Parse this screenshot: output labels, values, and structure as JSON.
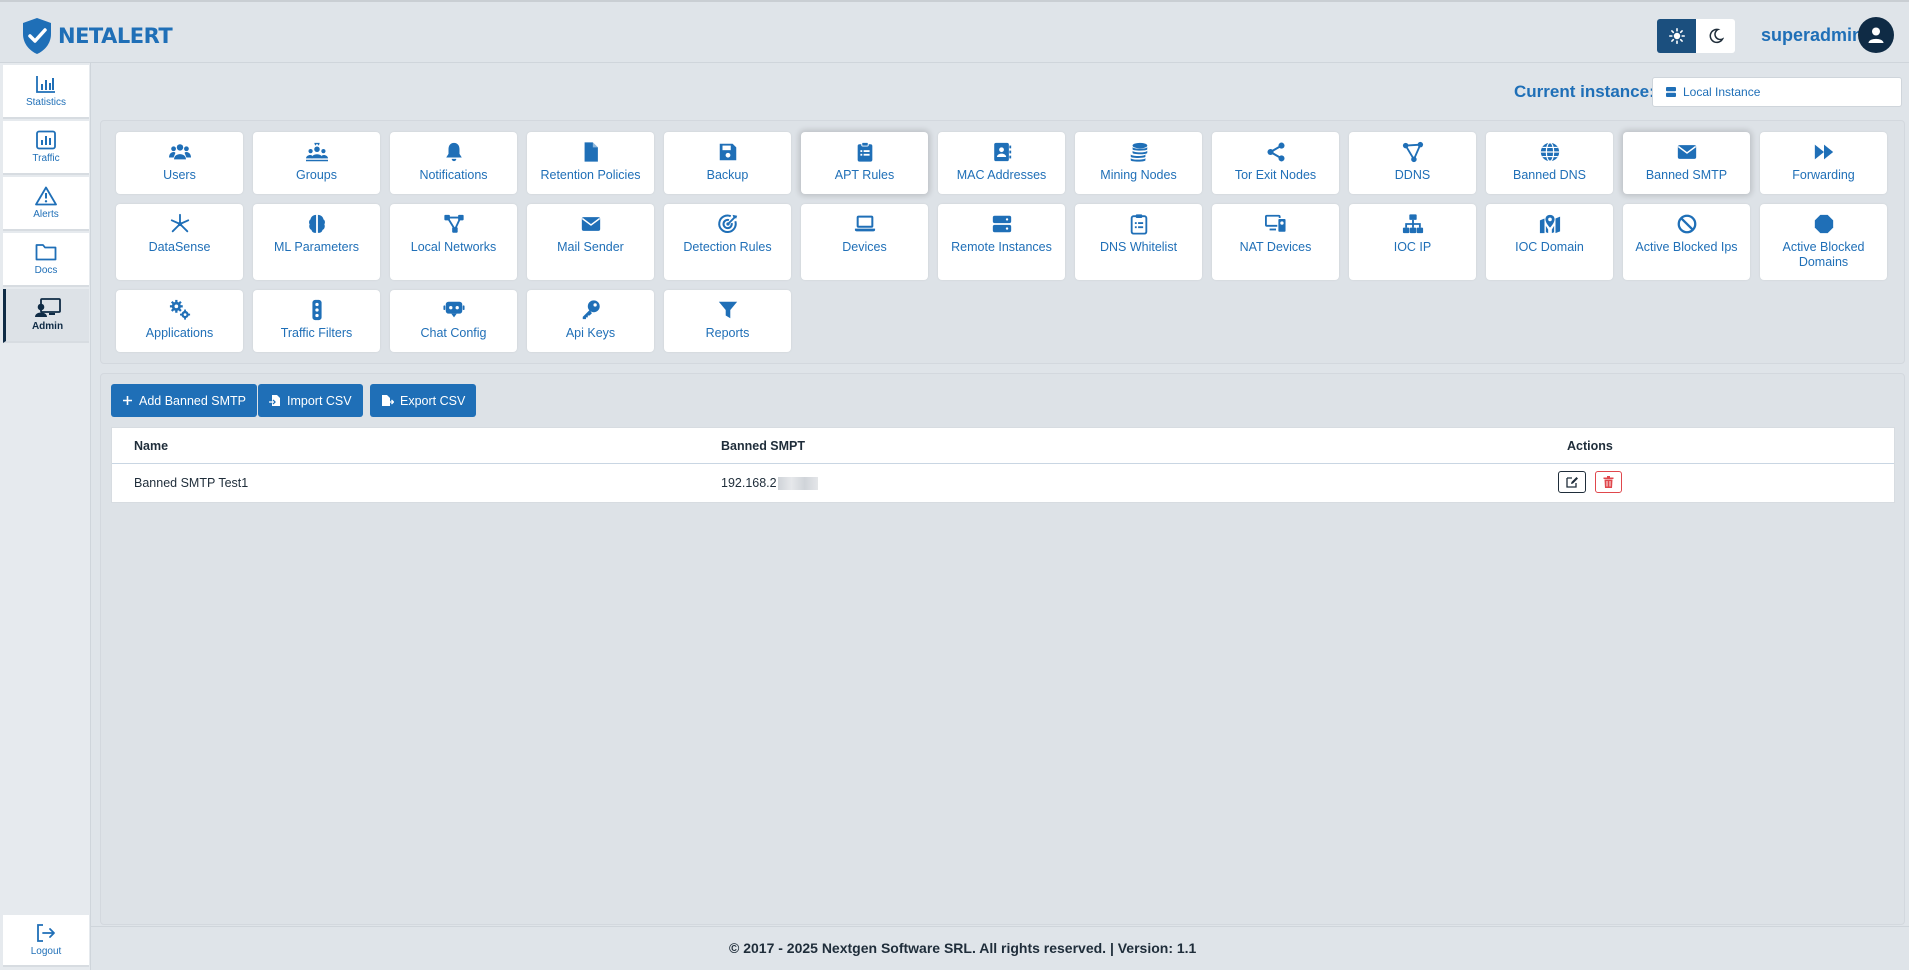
{
  "brand": {
    "name": "NETALERT"
  },
  "header": {
    "username": "superadmin"
  },
  "sidebar": {
    "items": [
      {
        "label": "Statistics",
        "icon": "bar-chart-icon"
      },
      {
        "label": "Traffic",
        "icon": "chart-square-icon"
      },
      {
        "label": "Alerts",
        "icon": "warning-triangle-icon"
      },
      {
        "label": "Docs",
        "icon": "folder-icon"
      },
      {
        "label": "Admin",
        "icon": "admin-screen-icon"
      }
    ],
    "logout": {
      "label": "Logout",
      "icon": "logout-icon"
    }
  },
  "instance": {
    "label": "Current instance:",
    "value": "Local Instance"
  },
  "tiles": [
    {
      "label": "Users",
      "icon": "users-icon"
    },
    {
      "label": "Groups",
      "icon": "groups-icon"
    },
    {
      "label": "Notifications",
      "icon": "bell-icon"
    },
    {
      "label": "Retention Policies",
      "icon": "file-icon"
    },
    {
      "label": "Backup",
      "icon": "floppy-icon"
    },
    {
      "label": "APT Rules",
      "icon": "clipboard-icon"
    },
    {
      "label": "MAC Addresses",
      "icon": "address-book-icon"
    },
    {
      "label": "Mining Nodes",
      "icon": "coins-icon"
    },
    {
      "label": "Tor Exit Nodes",
      "icon": "share-icon"
    },
    {
      "label": "DDNS",
      "icon": "nodes-icon"
    },
    {
      "label": "Banned DNS",
      "icon": "globe-icon"
    },
    {
      "label": "Banned SMTP",
      "icon": "envelope-icon"
    },
    {
      "label": "Forwarding",
      "icon": "forward-icon"
    },
    {
      "label": "DataSense",
      "icon": "sparkle-icon"
    },
    {
      "label": "ML Parameters",
      "icon": "brain-icon"
    },
    {
      "label": "Local Networks",
      "icon": "network-icon"
    },
    {
      "label": "Mail Sender",
      "icon": "envelope-icon"
    },
    {
      "label": "Detection Rules",
      "icon": "target-icon"
    },
    {
      "label": "Devices",
      "icon": "laptop-icon"
    },
    {
      "label": "Remote Instances",
      "icon": "server-icon"
    },
    {
      "label": "DNS Whitelist",
      "icon": "clipboard-list-icon"
    },
    {
      "label": "NAT Devices",
      "icon": "desktop-device-icon"
    },
    {
      "label": "IOC IP",
      "icon": "sitemap-icon"
    },
    {
      "label": "IOC Domain",
      "icon": "map-pin-icon"
    },
    {
      "label": "Active Blocked Ips",
      "icon": "ban-icon"
    },
    {
      "label": "Active Blocked Domains",
      "icon": "octagon-icon"
    },
    {
      "label": "Applications",
      "icon": "gears-icon"
    },
    {
      "label": "Traffic Filters",
      "icon": "traffic-light-icon"
    },
    {
      "label": "Chat Config",
      "icon": "robot-icon"
    },
    {
      "label": "Api Keys",
      "icon": "key-icon"
    },
    {
      "label": "Reports",
      "icon": "filter-icon"
    }
  ],
  "toolbar": {
    "add_label": "Add Banned SMTP",
    "import_label": "Import CSV",
    "export_label": "Export CSV"
  },
  "table": {
    "headers": {
      "name": "Name",
      "value": "Banned SMPT",
      "actions": "Actions"
    },
    "rows": [
      {
        "name": "Banned SMTP Test1",
        "value": "192.168.2"
      }
    ]
  },
  "footer": {
    "text": "© 2017 - 2025 Nextgen Software SRL. All rights reserved. | Version: 1.1"
  },
  "colors": {
    "accent": "#1f6fb7",
    "dark": "#0f2b45",
    "danger": "#e0474c"
  }
}
